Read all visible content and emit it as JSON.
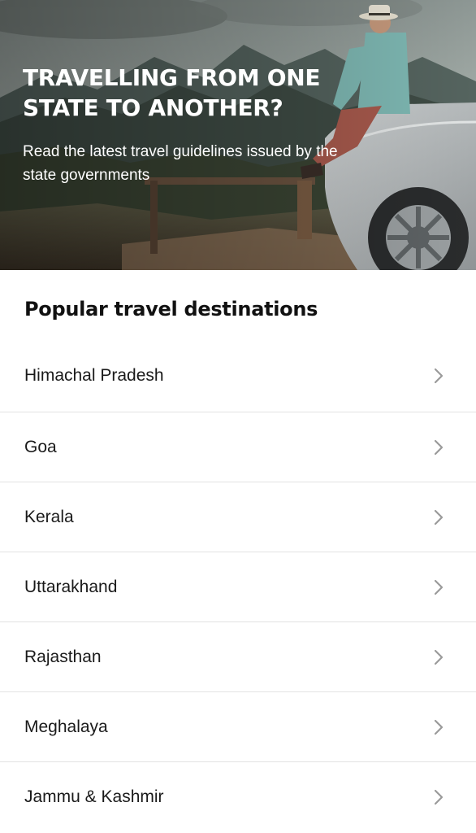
{
  "banner": {
    "headline_line1": "TRAVELLING FROM ONE",
    "headline_line2": "STATE TO ANOTHER?",
    "subline_line1": "Read the latest travel guidelines issued by the",
    "subline_line2": "state governments",
    "image": "traveller-sitting-on-car-hood-in-mountains"
  },
  "section": {
    "title": "Popular travel destinations"
  },
  "destinations": [
    {
      "label": "Himachal Pradesh"
    },
    {
      "label": "Goa"
    },
    {
      "label": "Kerala"
    },
    {
      "label": "Uttarakhand"
    },
    {
      "label": "Rajasthan"
    },
    {
      "label": "Meghalaya"
    },
    {
      "label": "Jammu & Kashmir"
    }
  ],
  "icons": {
    "chevron": "chevron-right-icon"
  },
  "colors": {
    "chevron": "#9a9a9a",
    "divider": "#e2e2e2",
    "text": "#1a1a1a"
  }
}
